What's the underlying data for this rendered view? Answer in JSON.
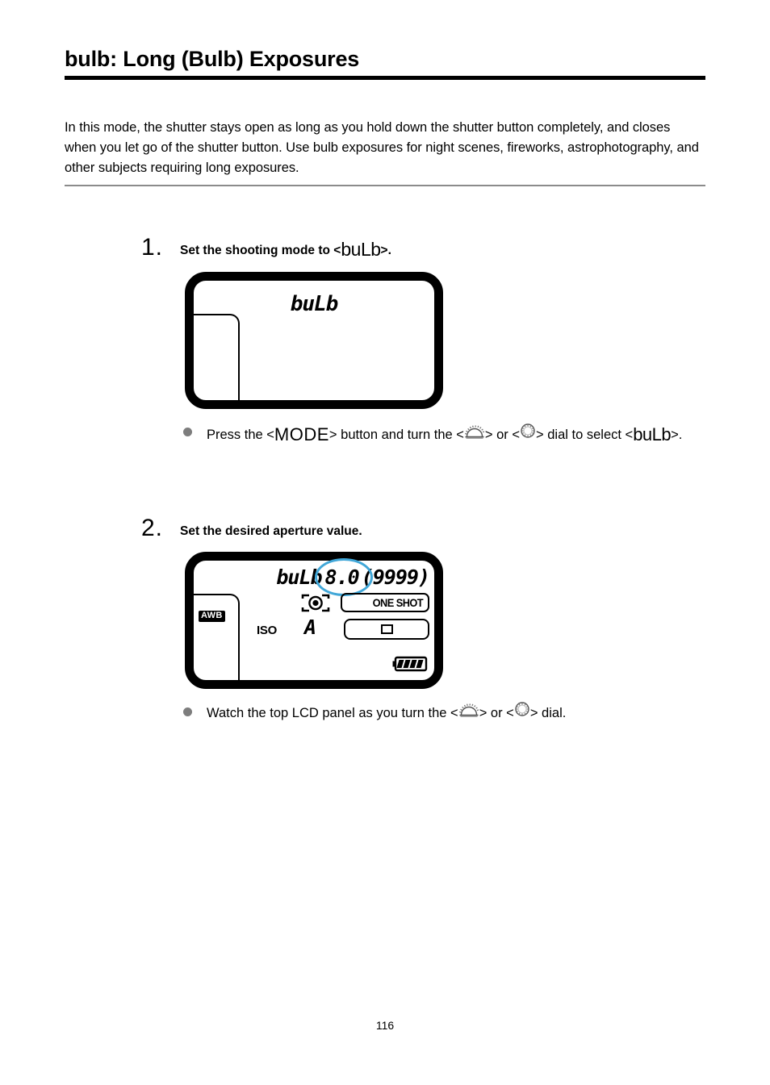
{
  "document": {
    "title": "bulb: Long (Bulb) Exposures",
    "intro": "In this mode, the shutter stays open as long as you hold down the shutter button completely, and closes when you let go of the shutter button. Use bulb exposures for night scenes, fireworks, astrophotography, and other subjects requiring long exposures.",
    "page_number": "116"
  },
  "colors": {
    "highlight_ellipse": "#41a7d8",
    "title_rule": "#000000",
    "intro_rule": "#8b8b8b",
    "bullet_dot": "#7d7d7d"
  },
  "steps": [
    {
      "number": "1.",
      "title_prefix": "Set the shooting mode to <",
      "title_mode": "buLb",
      "title_suffix": ">.",
      "lcd": {
        "mode_text": "buLb"
      },
      "bullet": {
        "part1": "Press the <",
        "mode_button": "MODE",
        "part2": "> button and turn the <",
        "dial1_icon": "main-dial-icon",
        "part3": "> or <",
        "dial2_icon": "quick-control-dial-icon",
        "part4": "> dial to select <",
        "bulb_label": "buLb",
        "part5": ">."
      }
    },
    {
      "number": "2.",
      "title_prefix": "Set the desired aperture value.",
      "lcd": {
        "mode_text": "buLb",
        "aperture": "8.0",
        "shots_remaining": "(9999)",
        "white_balance": "AWB",
        "iso_label": "ISO",
        "iso_value": "A",
        "metering_icon": "evaluative-metering-icon",
        "af_mode": "ONE SHOT",
        "drive_icon": "single-shooting-icon",
        "battery_icon": "battery-full-icon"
      },
      "bullet": {
        "part1": "Watch the top LCD panel as you turn the <",
        "dial1_icon": "main-dial-icon",
        "part2": "> or <",
        "dial2_icon": "quick-control-dial-icon",
        "part3": "> dial."
      }
    }
  ]
}
